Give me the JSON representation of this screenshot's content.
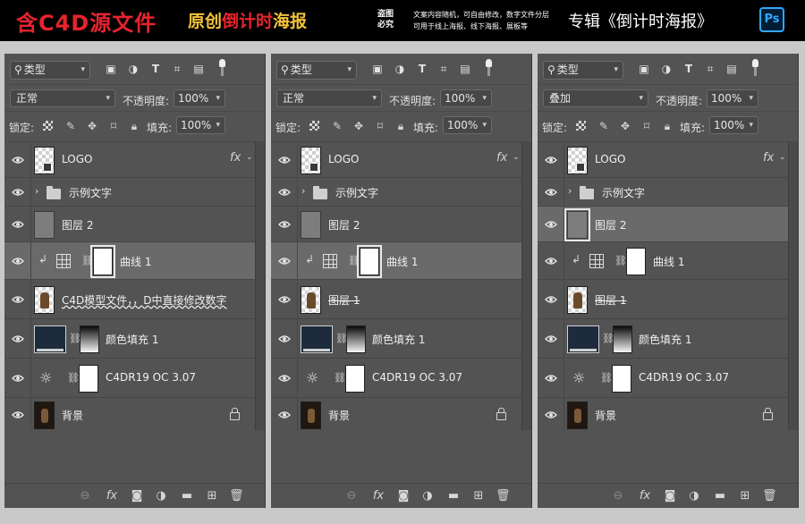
{
  "banner": {
    "title_prefix": "含C4D源文件",
    "title_mid_a": "原创",
    "title_mid_b": "倒计时",
    "title_mid_c": "海报",
    "warning": "盗图必究",
    "note_line1": "文案内容随机，可自由修改，数字文件分层",
    "note_line2": "可用于线上海报、线下海报、展板等",
    "album": "专辑《倒计时海报》",
    "ps_badge": "Ps"
  },
  "colors": {
    "banner_red": "#e6242e",
    "banner_yellow": "#f2c23a",
    "panel_bg": "#535353",
    "selected_row": "#6a6a6a"
  },
  "panels": [
    {
      "filter": "类型",
      "blend": "正常",
      "opacity_label": "不透明度:",
      "opacity": "100%",
      "lock_label": "锁定:",
      "fill_label": "填充:",
      "fill": "100%",
      "layers": [
        {
          "name": "LOGO"
        },
        {
          "name": "示例文字"
        },
        {
          "name": "图层 2"
        },
        {
          "name": "曲线 1"
        },
        {
          "name": "C4D模型文件，，D中直接修改数字"
        },
        {
          "name": "颜色填充 1"
        },
        {
          "name": "C4DR19 OC 3.07"
        },
        {
          "name": "背景"
        }
      ]
    },
    {
      "filter": "类型",
      "blend": "正常",
      "opacity_label": "不透明度:",
      "opacity": "100%",
      "lock_label": "锁定:",
      "fill_label": "填充:",
      "fill": "100%",
      "layers": [
        {
          "name": "LOGO"
        },
        {
          "name": "示例文字"
        },
        {
          "name": "图层 2"
        },
        {
          "name": "曲线 1"
        },
        {
          "name": "图层 1"
        },
        {
          "name": "颜色填充 1"
        },
        {
          "name": "C4DR19 OC 3.07"
        },
        {
          "name": "背景"
        }
      ]
    },
    {
      "filter": "类型",
      "blend": "叠加",
      "opacity_label": "不透明度:",
      "opacity": "100%",
      "lock_label": "锁定:",
      "fill_label": "填充:",
      "fill": "100%",
      "layers": [
        {
          "name": "LOGO"
        },
        {
          "name": "示例文字"
        },
        {
          "name": "图层 2"
        },
        {
          "name": "曲线 1"
        },
        {
          "name": "图层 1"
        },
        {
          "name": "颜色填充 1"
        },
        {
          "name": "C4DR19 OC 3.07"
        },
        {
          "name": "背景"
        }
      ]
    }
  ],
  "icons": {
    "eye": "eye-icon",
    "lock": "lock-icon",
    "fx": "fx",
    "chain": "chain-link-icon"
  }
}
